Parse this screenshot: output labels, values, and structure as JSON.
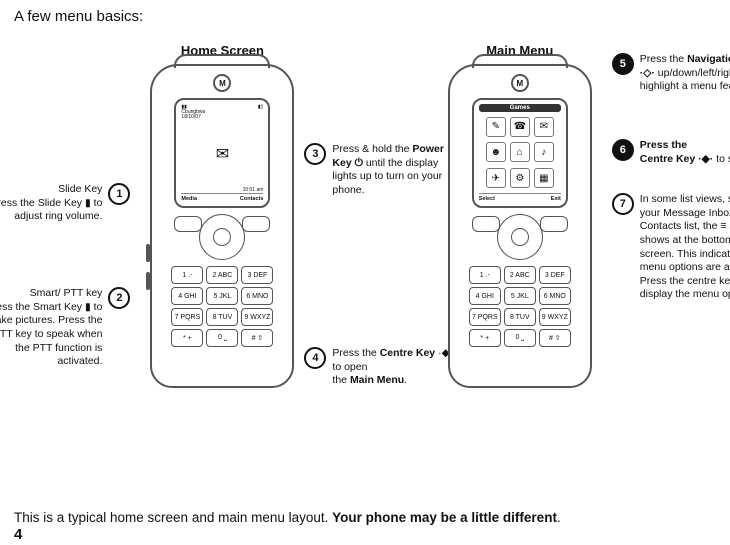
{
  "intro": "A few menu basics:",
  "titles": {
    "home": "Home Screen",
    "menu": "Main Menu"
  },
  "home": {
    "signal": "▮▮",
    "battery": "▮▯",
    "carrier": "Cbungbwa",
    "date": "18/10/07",
    "midglyph": "✉",
    "time": "10:01 am",
    "softL": "Media",
    "softR": "Contacts"
  },
  "menu": {
    "header": "Games",
    "icons": {
      "i0": "✎",
      "i1": "☎",
      "i2": "✉",
      "i3": "☻",
      "i4": "⌂",
      "i5": "♪",
      "i6": "✈",
      "i7": "⚙",
      "i8": "▦"
    },
    "softL": "Select",
    "softR": "Exit"
  },
  "keypad": {
    "k0": "1 .-",
    "k1": "2 ABC",
    "k2": "3 DEF",
    "k3": "4 GHI",
    "k4": "5 JKL",
    "k5": "6 MNO",
    "k6": "7 PQRS",
    "k7": "8 TUV",
    "k8": "9 WXYZ",
    "k9": "* +",
    "k10": "0 ⎵",
    "k11": "# ⇧"
  },
  "callouts": {
    "c1": {
      "n": "1",
      "title": "Slide Key",
      "text": "Press the Slide Key ▮ to adjust ring volume."
    },
    "c2": {
      "n": "2",
      "title": "Smart/ PTT key",
      "text": "Press the Smart Key ▮ to take pictures. Press the PTT key to speak when the PTT function is activated."
    },
    "c3": {
      "n": "3",
      "pre": "Press & hold the ",
      "bold": "Power Key ⏻",
      "post": " until the display lights up to turn on your phone."
    },
    "c4": {
      "n": "4",
      "pre": "Press the ",
      "bold1": "Centre Key",
      "mid": " ·◆·  to open",
      "pre2": "the ",
      "bold2": "Main Menu",
      "end": "."
    },
    "c5": {
      "n": "5",
      "pre": "Press the ",
      "bold": "Navigation Key ·◇·",
      "post": " up/down/left/right to highlight a menu feature."
    },
    "c6": {
      "n": "6",
      "pre": "Press the",
      "bold": "Centre Key ·◆·",
      "post": " to select it."
    },
    "c7": {
      "n": "7",
      "text": "In some list views, such as your Message Inbox or Contacts list, the ≡ symbol shows at the bottom of the screen. This indicates that menu options are available. Press the centre key ◆ to display the menu options."
    }
  },
  "footer": {
    "pre": "This is a typical home screen and main menu layout. ",
    "bold": "Your phone may be a little different",
    "end": "."
  },
  "pagenum": "4"
}
